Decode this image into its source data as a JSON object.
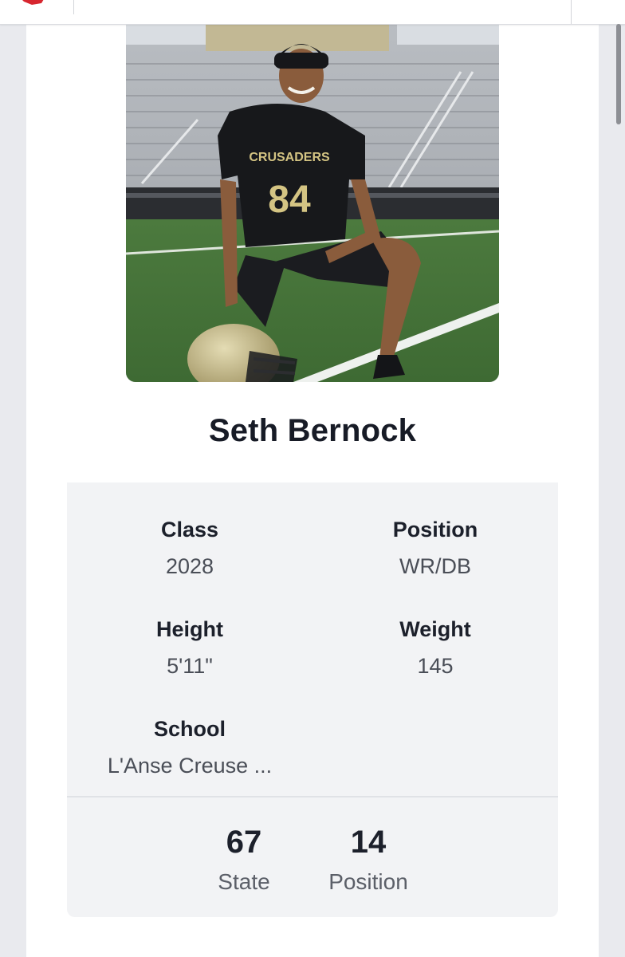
{
  "player": {
    "name": "Seth Bernock",
    "photo": {
      "jersey_team": "CRUSADERS",
      "jersey_number": "84"
    }
  },
  "details": [
    {
      "label": "Class",
      "value": "2028"
    },
    {
      "label": "Position",
      "value": "WR/DB"
    },
    {
      "label": "Height",
      "value": "5'11\""
    },
    {
      "label": "Weight",
      "value": "145"
    },
    {
      "label": "School",
      "value": "L'Anse Creuse ..."
    }
  ],
  "rankings": [
    {
      "value": "67",
      "label": "State"
    },
    {
      "value": "14",
      "label": "Position"
    }
  ],
  "colors": {
    "brand": "#d7262f",
    "panel_bg": "#f2f3f5",
    "page_bg": "#e9eaee"
  },
  "icons": {
    "logo": "brand-logo-icon",
    "menu": "menu-icon"
  }
}
